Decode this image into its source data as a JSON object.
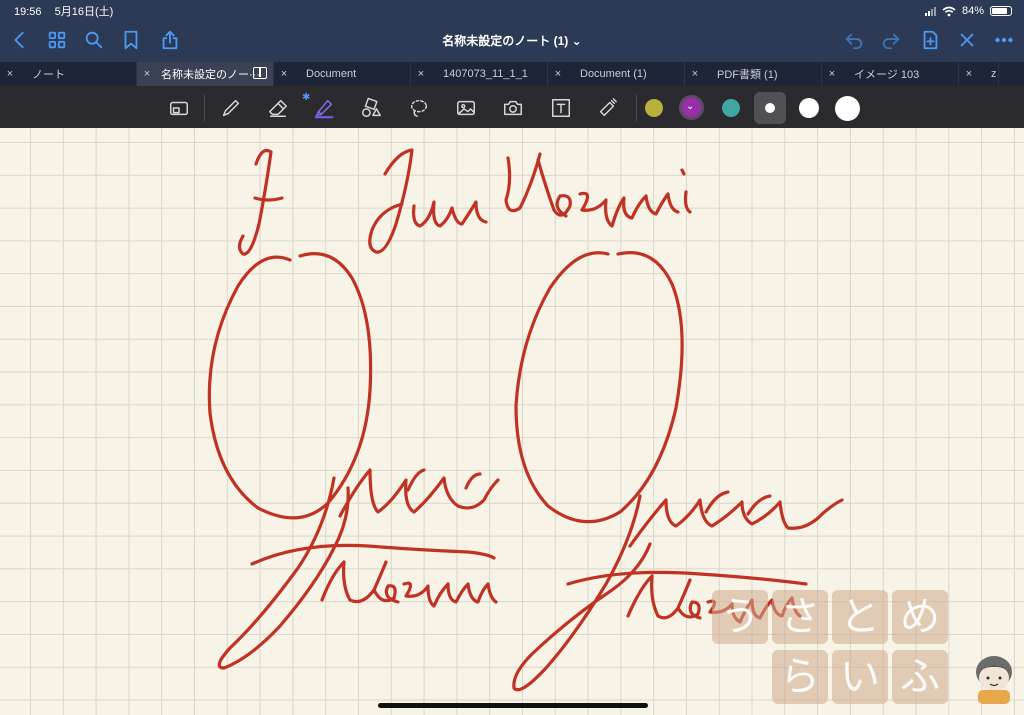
{
  "status": {
    "time": "19:56",
    "date": "5月16日(土)",
    "battery": "84%",
    "battery_level": 0.84
  },
  "nav": {
    "title": "名称未設定のノート (1)",
    "title_chevron": "⌄",
    "left_icons": [
      "back-icon",
      "grid-icon",
      "search-icon",
      "bookmark-icon",
      "share-icon"
    ],
    "right_icons": [
      "undo-icon",
      "redo-icon",
      "add-page-icon",
      "close-icon",
      "more-icon"
    ]
  },
  "tabs": [
    {
      "label": "ノート",
      "active": false
    },
    {
      "label": "名称未設定のノー···",
      "active": true
    },
    {
      "label": "Document",
      "active": false
    },
    {
      "label": "1407073_11_1_1",
      "active": false
    },
    {
      "label": "Document (1)",
      "active": false
    },
    {
      "label": "PDF書類 (1)",
      "active": false
    },
    {
      "label": "イメージ 103",
      "active": false
    },
    {
      "label": "z",
      "active": false
    }
  ],
  "toolbar": {
    "bluetooth": "✱",
    "tools": [
      "zoom-window-icon",
      "pen-icon",
      "eraser-icon",
      "highlighter-icon",
      "shape-icon",
      "lasso-icon",
      "image-icon",
      "camera-icon",
      "text-icon",
      "laser-pointer-icon"
    ],
    "colors": [
      "#b7b03a",
      "#9b2fa8",
      "#3fa6a1"
    ],
    "selected_color": "#9b2fa8",
    "sizes": [
      "small",
      "medium",
      "large"
    ]
  },
  "canvas": {
    "ink_color": "#c03224",
    "handwriting": [
      "J Jun Uozumi",
      "Jun Uozumi",
      "Jun Uozumi"
    ],
    "watermark": [
      "う",
      "さ",
      "と",
      "め",
      "ら",
      "い",
      "ふ"
    ]
  }
}
